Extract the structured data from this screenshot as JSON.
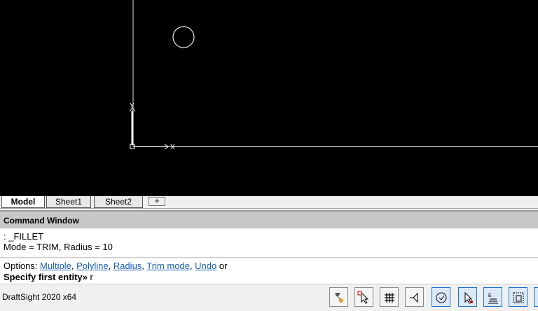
{
  "tabs": [
    {
      "label": "Model",
      "active": true
    },
    {
      "label": "Sheet1",
      "active": false
    },
    {
      "label": "Sheet2",
      "active": false
    }
  ],
  "tab_add_label": "+",
  "canvas": {
    "x_axis_label": "X",
    "y_axis_label": "Y"
  },
  "command_window": {
    "title": "Command Window",
    "history_line1": ": _FILLET",
    "history_line2": "Mode = TRIM, Radius = 10",
    "options_prefix": "Options: ",
    "options": [
      "Multiple",
      "Polyline",
      "Radius",
      "Trim mode",
      "Undo"
    ],
    "options_sep": ", ",
    "options_suffix": " or",
    "prompt": "Specify first entity»",
    "input_value": " r"
  },
  "statusbar": {
    "app_name": "DraftSight 2020 x64",
    "buttons": [
      {
        "icon": "snap-icon",
        "on": false
      },
      {
        "icon": "cursor-select-icon",
        "on": false
      },
      {
        "icon": "grid-icon",
        "on": false
      },
      {
        "icon": "ortho-icon",
        "on": false
      },
      {
        "icon": "esnap-circle-icon",
        "on": true
      },
      {
        "icon": "etrack-icon",
        "on": true
      },
      {
        "icon": "quick-input-icon",
        "on": true
      },
      {
        "icon": "dynamic-icon",
        "on": true
      }
    ]
  }
}
